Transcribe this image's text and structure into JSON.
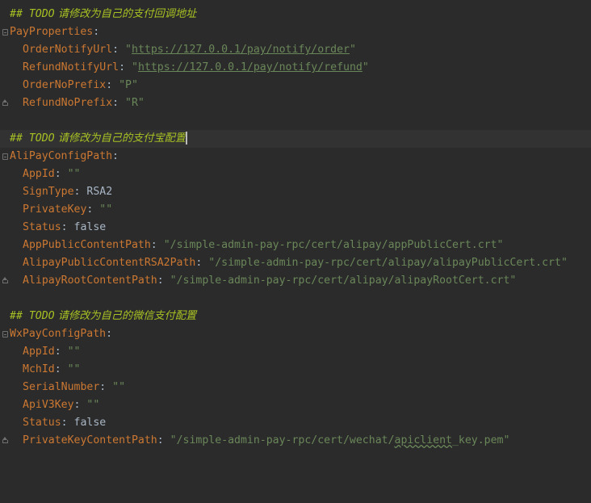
{
  "editor": {
    "colors": {
      "background": "#2b2b2b",
      "current_line": "#323232",
      "comment": "#a8c023",
      "key": "#cc7832",
      "string": "#6a8759",
      "plain": "#a9b7c6"
    },
    "pay": {
      "comment_prefix": "## ",
      "comment_todo": "TODO",
      "comment_text": " 请修改为自己的支付回调地址",
      "section_key": "PayProperties",
      "order_notify_key": "OrderNotifyUrl",
      "order_notify_url": "https://127.0.0.1/pay/notify/order",
      "refund_notify_key": "RefundNotifyUrl",
      "refund_notify_url": "https://127.0.0.1/pay/notify/refund",
      "order_prefix_key": "OrderNoPrefix",
      "order_prefix_value": "\"P\"",
      "refund_prefix_key": "RefundNoPrefix",
      "refund_prefix_value": "\"R\""
    },
    "alipay": {
      "comment_prefix": "## ",
      "comment_todo": "TODO",
      "comment_text": " 请修改为自己的支付宝配置",
      "section_key": "AliPayConfigPath",
      "appid_key": "AppId",
      "appid_value": "\"\"",
      "signtype_key": "SignType",
      "signtype_value": "RSA2",
      "privatekey_key": "PrivateKey",
      "privatekey_value": "\"\"",
      "status_key": "Status",
      "status_value": "false",
      "app_public_key": "AppPublicContentPath",
      "app_public_value": "\"/simple-admin-pay-rpc/cert/alipay/appPublicCert.crt\"",
      "alipay_public_key": "AlipayPublicContentRSA2Path",
      "alipay_public_value": "\"/simple-admin-pay-rpc/cert/alipay/alipayPublicCert.crt\"",
      "alipay_root_key": "AlipayRootContentPath",
      "alipay_root_value": "\"/simple-admin-pay-rpc/cert/alipay/alipayRootCert.crt\""
    },
    "wxpay": {
      "comment_prefix": "## ",
      "comment_todo": "TODO",
      "comment_text": " 请修改为自己的微信支付配置",
      "section_key": "WxPayConfigPath",
      "appid_key": "AppId",
      "appid_value": "\"\"",
      "mchid_key": "MchId",
      "mchid_value": "\"\"",
      "serial_key": "SerialNumber",
      "serial_value": "\"\"",
      "apiv3_key": "ApiV3Key",
      "apiv3_value": "\"\"",
      "status_key": "Status",
      "status_value": "false",
      "privkey_path_key": "PrivateKeyContentPath",
      "privkey_path_prefix": "\"/simple-admin-pay-rpc/cert/wechat/",
      "privkey_path_typo": "apiclient",
      "privkey_path_suffix": "_key.pem\""
    }
  }
}
